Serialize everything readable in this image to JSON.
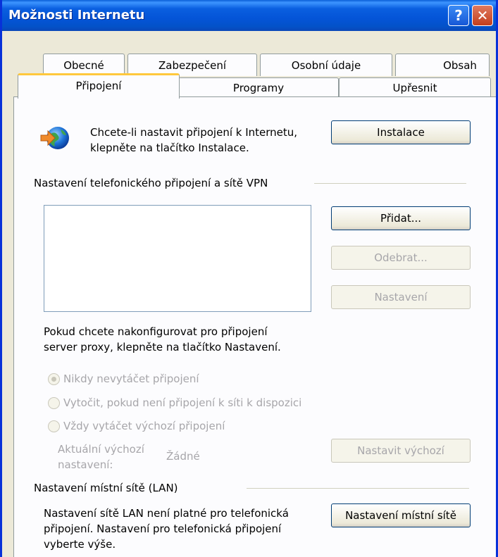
{
  "window": {
    "title": "Možnosti Internetu",
    "help_glyph": "?",
    "close_glyph": "✕"
  },
  "tabs_row1": [
    "Obecné",
    "Zabezpečení",
    "Osobní údaje",
    "Obsah"
  ],
  "tabs_row2": [
    "Připojení",
    "Programy",
    "Upřesnit"
  ],
  "active_tab": "Připojení",
  "setup": {
    "text_line1": "Chcete-li nastavit připojení k Internetu,",
    "text_line2": "klepněte na tlačítko Instalace.",
    "button": "Instalace"
  },
  "dialup": {
    "group_label": "Nastavení telefonického připojení a sítě VPN",
    "add_button": "Přidat...",
    "remove_button": "Odebrat...",
    "settings_button": "Nastavení",
    "proxy_line1": "Pokud chcete nakonfigurovat pro připojení",
    "proxy_line2": "server proxy, klepněte na tlačítko Nastavení.",
    "radio_options": [
      "Nikdy nevytáčet připojení",
      "Vytočit, pokud není připojení k síti k dispozici",
      "Vždy vytáčet výchozí připojení"
    ],
    "selected_option": "Nikdy nevytáčet připojení",
    "current_default_line1": "Aktuální výchozí",
    "current_default_line2": "nastavení:",
    "current_default_value": "Žádné",
    "set_default_button": "Nastavit výchozí"
  },
  "lan": {
    "group_label": "Nastavení místní sítě (LAN)",
    "text_line1": "Nastavení sítě LAN není platné pro telefonická",
    "text_line2": "připojení. Nastavení pro telefonická připojení",
    "text_line3": "vyberte výše.",
    "button": "Nastavení místní sítě"
  },
  "icons": {
    "connection": "globe-connection-icon"
  },
  "colors": {
    "titlebar": "#0454d7",
    "active_tab_accent": "#ffc83c",
    "border": "#0831d9"
  }
}
